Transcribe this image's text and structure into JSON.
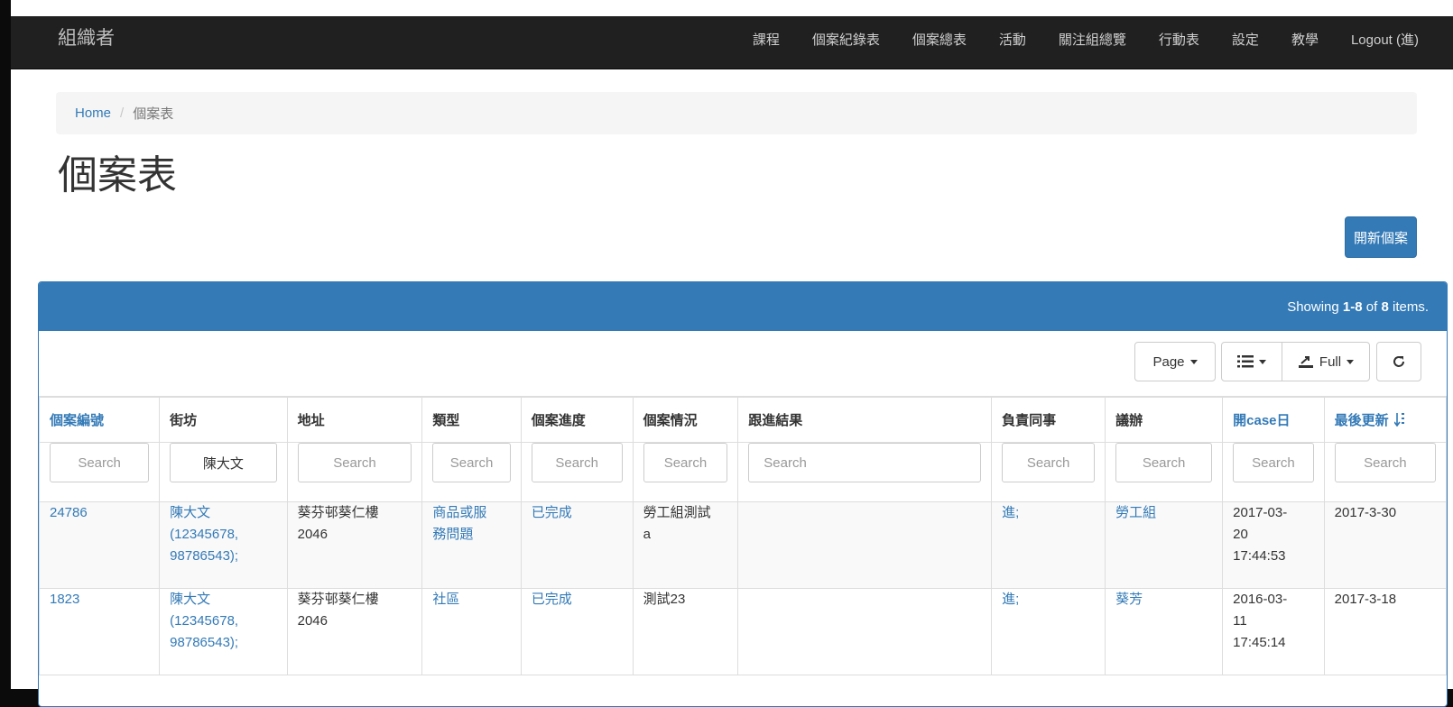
{
  "navbar": {
    "brand": "組織者",
    "items": [
      "課程",
      "個案紀錄表",
      "個案總表",
      "活動",
      "關注組總覽",
      "行動表",
      "設定",
      "教學",
      "Logout (進)"
    ]
  },
  "breadcrumb": {
    "home": "Home",
    "separator": "/",
    "current": "個案表"
  },
  "page_title": "個案表",
  "new_case_button": "開新個案",
  "panel": {
    "summary_prefix": "Showing ",
    "summary_range": "1-8",
    "summary_of": " of ",
    "summary_total": "8",
    "summary_suffix": " items."
  },
  "toolbar": {
    "page_label": "Page",
    "export_label": "Full",
    "icons": [
      "list-icon",
      "export-icon",
      "refresh-icon"
    ]
  },
  "table": {
    "columns": [
      "個案編號",
      "街坊",
      "地址",
      "類型",
      "個案進度",
      "個案情況",
      "跟進結果",
      "負責同事",
      "議辦",
      "開case日",
      "最後更新"
    ],
    "filters": [
      {
        "placeholder": "Search",
        "value": ""
      },
      {
        "placeholder": "Search",
        "value": "陳大文"
      },
      {
        "placeholder": "Search",
        "value": ""
      },
      {
        "placeholder": "Search",
        "value": ""
      },
      {
        "placeholder": "Search",
        "value": ""
      },
      {
        "placeholder": "Search",
        "value": ""
      },
      {
        "placeholder": "Search",
        "value": ""
      },
      {
        "placeholder": "Search",
        "value": ""
      },
      {
        "placeholder": "Search",
        "value": ""
      },
      {
        "placeholder": "Search",
        "value": ""
      },
      {
        "placeholder": "Search",
        "value": ""
      }
    ],
    "rows": [
      {
        "id": "24786",
        "resident": [
          "陳大文",
          "(12345678,",
          "98786543);"
        ],
        "address": [
          "葵芬邨葵仁樓",
          "2046"
        ],
        "type": [
          "商品或服",
          "務問題"
        ],
        "progress": "已完成",
        "situation": [
          "勞工組測試",
          "a"
        ],
        "followup": "",
        "staff": "進;",
        "issue": "勞工組",
        "opened": [
          "2017-03-",
          "20",
          "17:44:53"
        ],
        "updated": "2017-3-30"
      },
      {
        "id": "1823",
        "resident": [
          "陳大文",
          "(12345678,",
          "98786543);"
        ],
        "address": [
          "葵芬邨葵仁樓",
          "2046"
        ],
        "type": [
          "社區"
        ],
        "progress": "已完成",
        "situation": [
          "測試23"
        ],
        "followup": "",
        "staff": "進;",
        "issue": "葵芳",
        "opened": [
          "2016-03-",
          "11",
          "17:45:14"
        ],
        "updated": "2017-3-18"
      }
    ]
  },
  "colors": {
    "primary": "#337ab7",
    "navbar_bg": "#202020",
    "breadcrumb_bg": "#f5f5f5"
  }
}
